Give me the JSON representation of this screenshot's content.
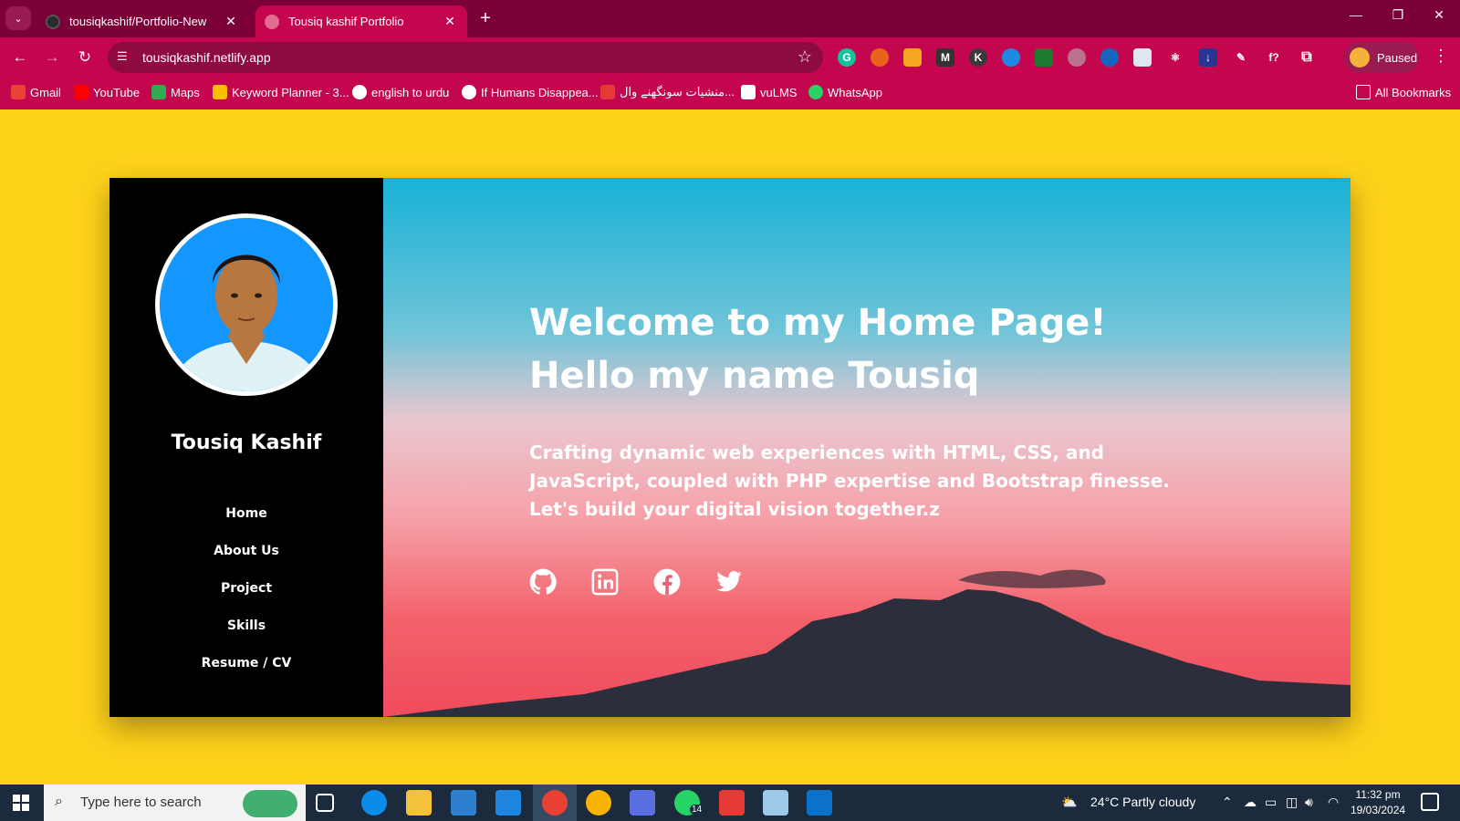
{
  "browser": {
    "tabs": [
      {
        "title": "tousiqkashif/Portfolio-New",
        "active": false
      },
      {
        "title": "Tousiq kashif Portfolio",
        "active": true
      }
    ],
    "url": "tousiqkashif.netlify.app",
    "profile_label": "Paused",
    "bookmarks": [
      "Gmail",
      "YouTube",
      "Maps",
      "Keyword Planner - 3...",
      "english to urdu",
      "If Humans Disappea...",
      "منشیات سونگھنے وال...",
      "vuLMS",
      "WhatsApp"
    ],
    "all_bookmarks_label": "All Bookmarks",
    "colors": {
      "tabbar": "#7a0037",
      "toolbar": "#c4064f"
    }
  },
  "sidebar": {
    "name": "Tousiq Kashif",
    "nav": [
      "Home",
      "About Us",
      "Project",
      "Skills",
      "Resume / CV"
    ]
  },
  "hero": {
    "heading_line1": "Welcome to my Home Page!",
    "heading_line2": "Hello my name Tousiq",
    "description": "Crafting dynamic web experiences with HTML, CSS, and JavaScript, coupled with PHP expertise and Bootstrap finesse. Let's build your digital vision together.z",
    "social_icons": [
      "github-icon",
      "linkedin-icon",
      "facebook-icon",
      "twitter-icon"
    ]
  },
  "page": {
    "background": "#ffd21a"
  },
  "taskbar": {
    "search_placeholder": "Type here to search",
    "whatsapp_badge": "14",
    "weather": "24°C  Partly cloudy",
    "time": "11:32 pm",
    "date": "19/03/2024"
  }
}
